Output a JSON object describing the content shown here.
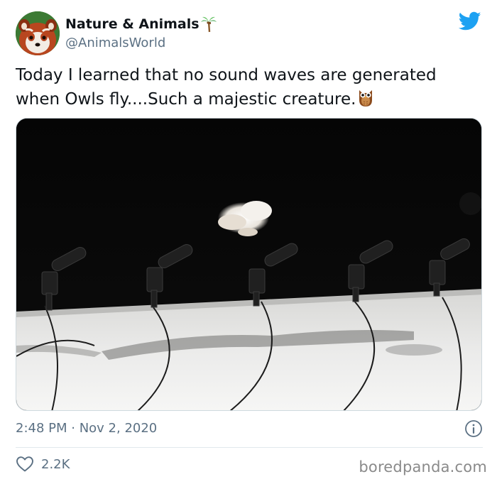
{
  "account": {
    "display_name": "Nature & Animals",
    "handle": "@AnimalsWorld"
  },
  "tweet": {
    "line1": "Today I learned that no sound waves are generated",
    "line2": "when Owls fly....Such a majestic creature."
  },
  "meta": {
    "timestamp": "2:48 PM · Nov 2, 2020"
  },
  "engagement": {
    "likes": "2.2K"
  },
  "watermark": "boredpanda.com",
  "icons": {
    "avatar": "red-panda-avatar",
    "verified_decoration": "palm-tree-emoji",
    "brand": "twitter-bird-icon",
    "emoji": "owl-emoji",
    "info": "info-icon",
    "like": "heart-icon"
  },
  "colors": {
    "twitter_blue": "#1da1f2",
    "secondary_text": "#5b7083",
    "primary_text": "#0f1419"
  }
}
